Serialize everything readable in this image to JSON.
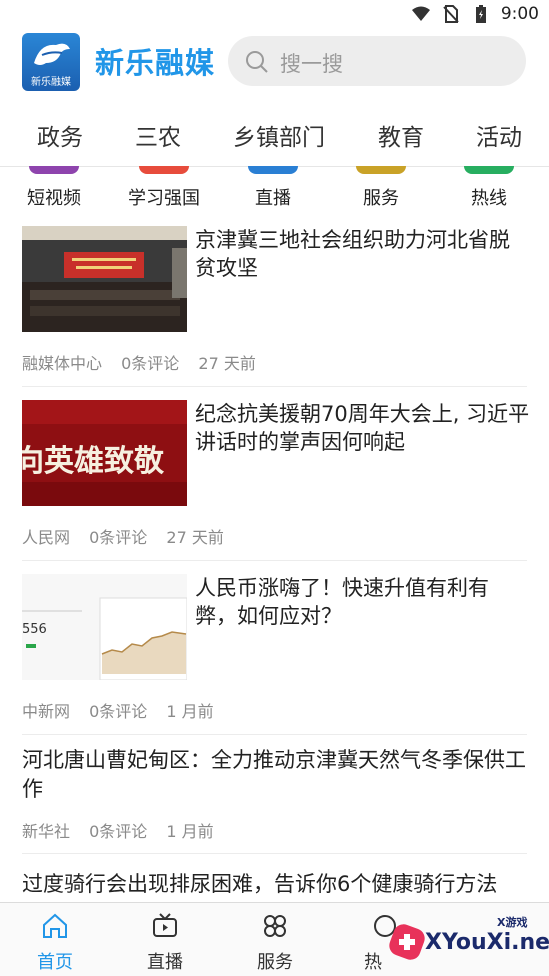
{
  "status_bar": {
    "time": "9:00",
    "icons": [
      "wifi-icon",
      "no-sim-icon",
      "battery-icon"
    ]
  },
  "header": {
    "app_title": "新乐融媒",
    "logo_text": "新乐融媒",
    "search_placeholder": "搜一搜"
  },
  "tabs": [
    "政务",
    "三农",
    "乡镇部门",
    "教育",
    "活动"
  ],
  "quick_entries": [
    {
      "label": "短视频",
      "color": "#8e44ad"
    },
    {
      "label": "学习强国",
      "color": "#e74c3c"
    },
    {
      "label": "直播",
      "color": "#2a7fd4"
    },
    {
      "label": "服务",
      "color": "#c9a227"
    },
    {
      "label": "热线",
      "color": "#27ae60"
    }
  ],
  "news": [
    {
      "title": "京津冀三地社会组织助力河北省脱贫攻坚",
      "source": "融媒体中心",
      "comments": "0条评论",
      "time": "27 天前"
    },
    {
      "title": "纪念抗美援朝70周年大会上, 习近平讲话时的掌声因何响起",
      "source": "人民网",
      "comments": "0条评论",
      "time": "27 天前",
      "thumb_text": "向英雄致敬"
    },
    {
      "title": "人民币涨嗨了！快速升值有利有弊，如何应对？",
      "source": "中新网",
      "comments": "0条评论",
      "time": "1 月前",
      "thumb_number": "556"
    },
    {
      "title": "河北唐山曹妃甸区：全力推动京津冀天然气冬季保供工作",
      "source": "新华社",
      "comments": "0条评论",
      "time": "1 月前"
    },
    {
      "title": "过度骑行会出现排尿困难，告诉你6个健康骑行方法"
    }
  ],
  "bottom_nav": [
    {
      "label": "首页",
      "icon": "home-icon",
      "active": true
    },
    {
      "label": "直播",
      "icon": "tv-icon"
    },
    {
      "label": "服务",
      "icon": "services-icon"
    },
    {
      "label": "热",
      "icon": "hot-icon"
    }
  ],
  "watermark": {
    "text": "XYouXi.net",
    "small": "X游戏"
  },
  "colors": {
    "accent": "#2196e8",
    "meta": "#8a8a8a"
  }
}
